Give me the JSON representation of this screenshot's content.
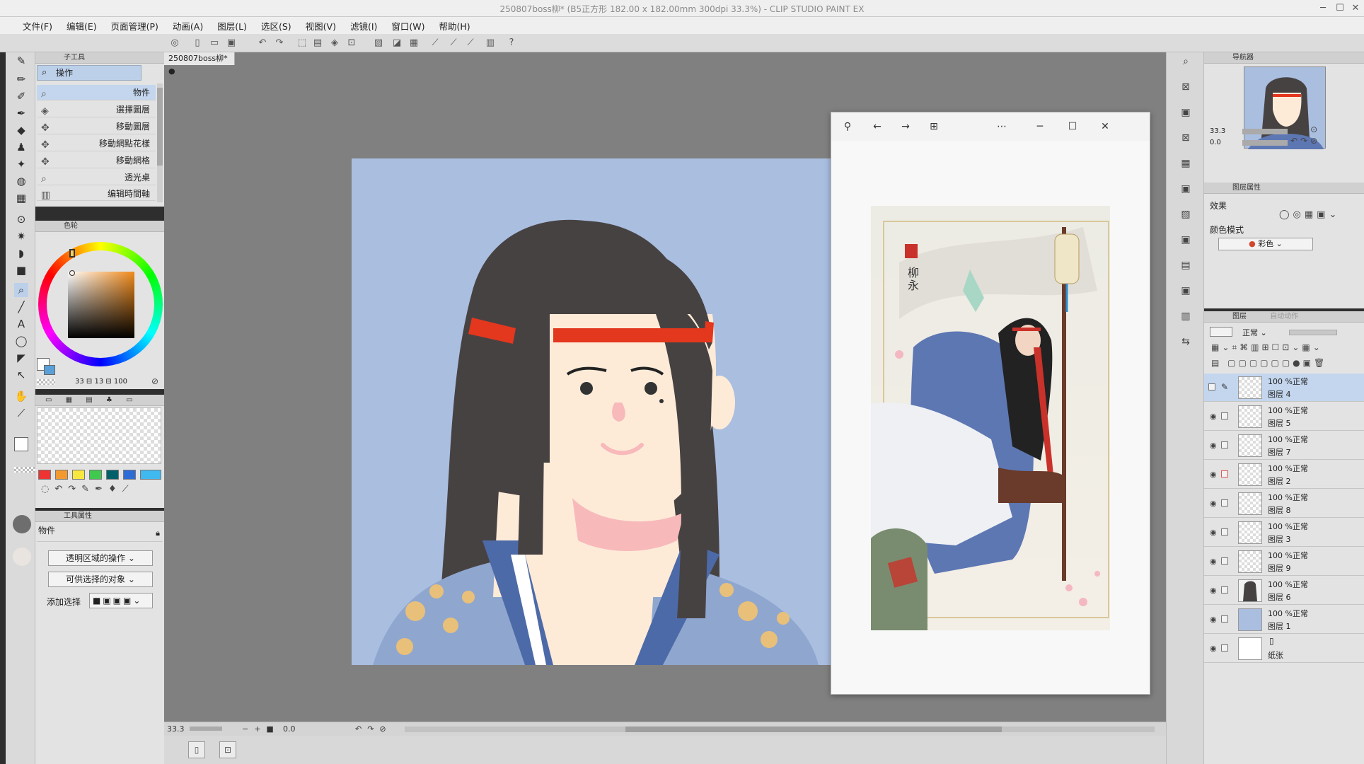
{
  "window": {
    "title": "250807boss柳* (B5正方形 182.00 x 182.00mm 300dpi 33.3%) - CLIP STUDIO PAINT EX"
  },
  "menu": [
    "文件(F)",
    "编辑(E)",
    "页面管理(P)",
    "动画(A)",
    "图层(L)",
    "选区(S)",
    "视图(V)",
    "滤镜(I)",
    "窗口(W)",
    "帮助(H)"
  ],
  "subtool": {
    "panel_title": "子工具",
    "group": "操作",
    "items": [
      "物件",
      "選擇圖層",
      "移動圖層",
      "移動網點花樣",
      "移動網格",
      "透光桌",
      "编辑時間軸"
    ]
  },
  "color": {
    "panel_title": "色轮",
    "readout": "33 ⊟ 13 ⊟ 100"
  },
  "swatches": [
    "#ee3333",
    "#f29a30",
    "#f7e840",
    "#3fc94f",
    "#00606a",
    "#2f6bd6",
    "#40b8f0"
  ],
  "tool_props": {
    "panel_title": "工具属性",
    "tool_name": "物件",
    "dropdown1": "透明区域的操作",
    "dropdown2": "可供选择的对象",
    "add_label": "添加选择"
  },
  "document": {
    "tab": "250807boss柳*"
  },
  "status": {
    "zoom": "33.3",
    "angle": "0.0"
  },
  "viewer": {
    "seal_text": "柳永"
  },
  "navigator": {
    "title": "导航器",
    "zoom": "33.3",
    "angle": "0.0"
  },
  "layer_property": {
    "title": "图层属性",
    "effect_label": "效果",
    "color_mode_label": "颜色模式",
    "color_mode_value": "彩色"
  },
  "layers": {
    "title": "图层",
    "title2": "自动动作",
    "blend": "正常",
    "items": [
      {
        "op": "100 %正常",
        "name": "图层 4",
        "thumb": "check"
      },
      {
        "op": "100 %正常",
        "name": "图层 5",
        "thumb": "check"
      },
      {
        "op": "100 %正常",
        "name": "图层 7",
        "thumb": "check"
      },
      {
        "op": "100 %正常",
        "name": "图层 2",
        "thumb": "check"
      },
      {
        "op": "100 %正常",
        "name": "图层 8",
        "thumb": "check"
      },
      {
        "op": "100 %正常",
        "name": "图层 3",
        "thumb": "check"
      },
      {
        "op": "100 %正常",
        "name": "图层 9",
        "thumb": "check"
      },
      {
        "op": "100 %正常",
        "name": "图层 6",
        "thumb": "check"
      },
      {
        "op": "100 %正常",
        "name": "图层 1",
        "thumb": "blue"
      },
      {
        "op": "",
        "name": "纸张",
        "thumb": "white"
      }
    ]
  }
}
